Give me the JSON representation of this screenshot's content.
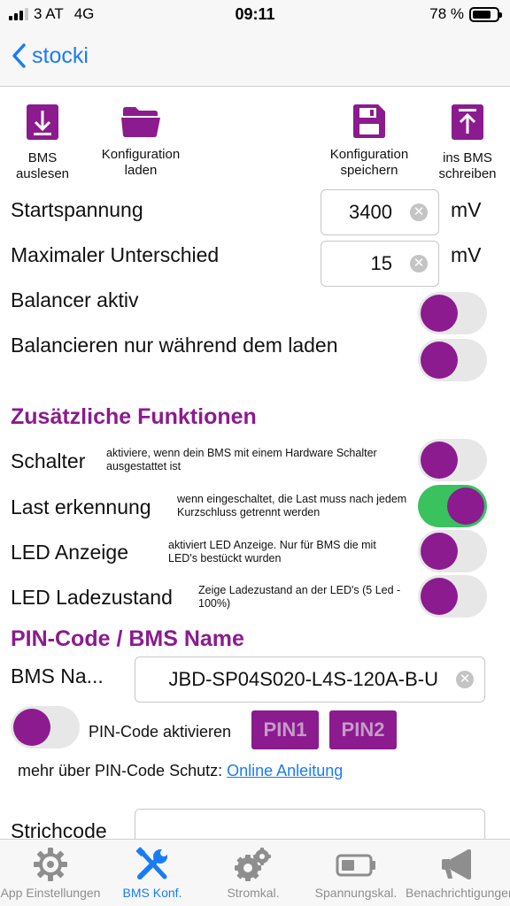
{
  "status": {
    "carrier": "3 AT",
    "network": "4G",
    "time": "09:11",
    "battery": "78 %",
    "battery_level": 0.78
  },
  "nav": {
    "back_label": "stocki"
  },
  "toolbar": {
    "read_bms": [
      "BMS",
      "auslesen"
    ],
    "load_config": [
      "Konfiguration",
      "laden"
    ],
    "save_config": [
      "Konfiguration",
      "speichern"
    ],
    "write_bms": [
      "ins BMS",
      "schreiben"
    ]
  },
  "settings": {
    "start_voltage": {
      "label": "Startspannung",
      "value": "3400",
      "unit": "mV"
    },
    "max_difference": {
      "label": "Maximaler Unterschied",
      "value": "15",
      "unit": "mV"
    },
    "balancer_active": {
      "label": "Balancer aktiv",
      "on": false
    },
    "balance_charging": {
      "label": "Balancieren nur während dem laden",
      "on": false
    }
  },
  "extra": {
    "title": "Zusätzliche Funktionen",
    "switch": {
      "label": "Schalter",
      "hint": "aktiviere, wenn dein BMS mit einem Hardware Schalter ausgestattet ist",
      "on": false
    },
    "load_detect": {
      "label": "Last erkennung",
      "hint": "wenn eingeschaltet, die Last muss nach jedem Kurzschluss getrennt werden",
      "on": true
    },
    "led_display": {
      "label": "LED Anzeige",
      "hint": "aktiviert LED Anzeige. Nur für BMS die mit LED's bestückt wurden",
      "on": false
    },
    "led_charge": {
      "label": "LED Ladezustand",
      "hint": "Zeige Ladezustand an der LED's (5 Led - 100%)",
      "on": false
    }
  },
  "pin": {
    "title": "PIN-Code / BMS Name",
    "bms_name_label": "BMS Na...",
    "bms_name_value": "JBD-SP04S020-L4S-120A-B-U",
    "activate_label": "PIN-Code aktivieren",
    "pin1": "PIN1",
    "pin2": "PIN2",
    "more_text": "mehr über PIN-Code Schutz:",
    "more_link": "Online Anleitung",
    "barcode_label": "Strichcode",
    "barcode_value": ""
  },
  "tabs": [
    {
      "label": "App Einstellungen",
      "icon": "gear-icon",
      "active": false
    },
    {
      "label": "BMS Konf.",
      "icon": "tools-icon",
      "active": true
    },
    {
      "label": "Stromkal.",
      "icon": "gears-icon",
      "active": false
    },
    {
      "label": "Spannungskal.",
      "icon": "battery-icon",
      "active": false
    },
    {
      "label": "Benachrichtigungen",
      "icon": "megaphone-icon",
      "active": false
    }
  ],
  "colors": {
    "accent": "#8b1b8e",
    "link": "#1a7cf5",
    "toggle_on": "#3ac25f",
    "toggle_off": "#e7e7e7"
  }
}
